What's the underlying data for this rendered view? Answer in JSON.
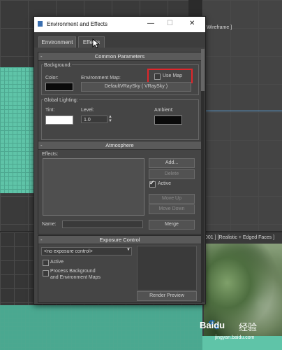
{
  "viewports": {
    "top_right_label": "Wireframe ]",
    "bottom_right_label": "001 ] [Realistic + Edged Faces ]",
    "watermark_brand": "Baidu",
    "watermark_word": "经验",
    "watermark_url": "jingyan.baidu.com"
  },
  "window": {
    "title": "Environment and Effects",
    "minimize": "—",
    "maximize": "☐",
    "close": "✕",
    "tabs": [
      {
        "label": "Environment"
      },
      {
        "label": "Effects"
      }
    ]
  },
  "common_parameters": {
    "header": "Common Parameters",
    "collapse_glyph": "-",
    "background_group": "Background:",
    "color_label": "Color:",
    "color_value": "#0a0a0a",
    "env_map_label": "Environment Map:",
    "use_map_label": "Use Map",
    "use_map_checked": false,
    "env_map_button": "DefaultVRaySky  ( VRaySky )",
    "global_lighting_group": "Global Lighting:",
    "tint_label": "Tint:",
    "tint_value": "#ffffff",
    "level_label": "Level:",
    "level_value": "1.0",
    "ambient_label": "Ambient:",
    "ambient_value": "#0a0a0a"
  },
  "atmosphere": {
    "header": "Atmosphere",
    "collapse_glyph": "-",
    "effects_label": "Effects:",
    "add_button": "Add...",
    "delete_button": "Delete",
    "active_label": "Active",
    "active_checked": true,
    "move_up_button": "Move Up",
    "move_down_button": "Move Down",
    "name_label": "Name:",
    "merge_button": "Merge"
  },
  "exposure_control": {
    "header": "Exposure Control",
    "collapse_glyph": "-",
    "dropdown_value": "<no exposure control>",
    "active_label": "Active",
    "active_checked": false,
    "process_bg_label_1": "Process Background",
    "process_bg_label_2": "and Environment Maps",
    "process_bg_checked": false,
    "render_preview_button": "Render Preview"
  },
  "colors": {
    "highlight": "#e0262b",
    "viewport_teal": "#5fc4a8"
  }
}
